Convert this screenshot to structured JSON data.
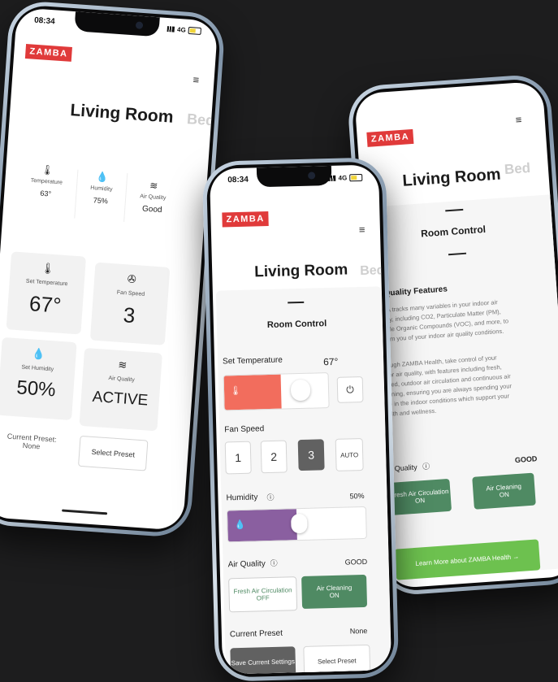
{
  "brand": "ZAMBA",
  "colors": {
    "brand_red": "#e03a3a",
    "temp_slider": "#f26d5d",
    "humidity_slider": "#8a5fa0",
    "accent_green": "#4f8a63",
    "learn_more_green": "#6dc14f"
  },
  "phone_left": {
    "status_time": "08:34",
    "network": "4G",
    "room_title": "Living Room",
    "next_room": "Bed",
    "readings": [
      {
        "icon": "thermometer-icon",
        "label": "Temperature",
        "value": "63°"
      },
      {
        "icon": "droplet-icon",
        "label": "Humidity",
        "value": "75%"
      },
      {
        "icon": "wind-icon",
        "label": "Air Quality",
        "value": "Good"
      }
    ],
    "tiles": [
      {
        "icon": "thermometer-icon",
        "label": "Set Temperature",
        "value": "67°"
      },
      {
        "icon": "fan-icon",
        "label": "Fan Speed",
        "value": "3"
      },
      {
        "icon": "droplet-icon",
        "label": "Set Humidity",
        "value": "50%"
      },
      {
        "icon": "wind-icon",
        "label": "Air Quality",
        "value": "ACTIVE"
      }
    ],
    "preset_label": "Current Preset:",
    "preset_value": "None",
    "select_preset": "Select Preset"
  },
  "phone_mid": {
    "status_time": "08:34",
    "network": "4G",
    "room_title": "Living Room",
    "next_room": "Bed",
    "room_control": "Room Control",
    "set_temperature_label": "Set Temperature",
    "set_temperature_value": "67°",
    "temperature_level": 0.55,
    "fan_speed_label": "Fan Speed",
    "fan_options": [
      "1",
      "2",
      "3",
      "AUTO"
    ],
    "fan_selected": "3",
    "humidity_label": "Humidity",
    "humidity_value": "50%",
    "humidity_level": 0.5,
    "air_quality_label": "Air Quality",
    "air_quality_value": "GOOD",
    "fresh_air_title": "Fresh Air Circulation",
    "fresh_air_state": "OFF",
    "air_cleaning_title": "Air Cleaning",
    "air_cleaning_state": "ON",
    "current_preset_label": "Current Preset",
    "current_preset_value": "None",
    "save_settings": "Save Current Settings",
    "select_preset": "Select Preset"
  },
  "phone_right": {
    "room_title": "Living Room",
    "next_room": "Bed",
    "room_control": "Room Control",
    "features_title": "ir Quality Features",
    "features_text_1": [
      "MBA tracks many variables in your indoor air",
      "uality, including CO2, Particulate Matter (PM),",
      "olatile Organic Compounds (VOC), and more, to",
      "nform you of your indoor air quality conditions."
    ],
    "features_text_2": [
      "hrough ZAMBA Health, take control of your",
      "door air quality, with features including fresh,",
      "ltered, outdoor air circulation and continuous air",
      "leaning, ensuring you are always spending your",
      "me in the indoor conditions which support your",
      "ealth and wellness."
    ],
    "air_quality_label": "ir Quality",
    "air_quality_value": "GOOD",
    "fresh_air_title": "Fresh Air Circulation",
    "fresh_air_state": "ON",
    "air_cleaning_title": "Air Cleaning",
    "air_cleaning_state": "ON",
    "learn_more": "Learn More about ZAMBA Health  →"
  }
}
